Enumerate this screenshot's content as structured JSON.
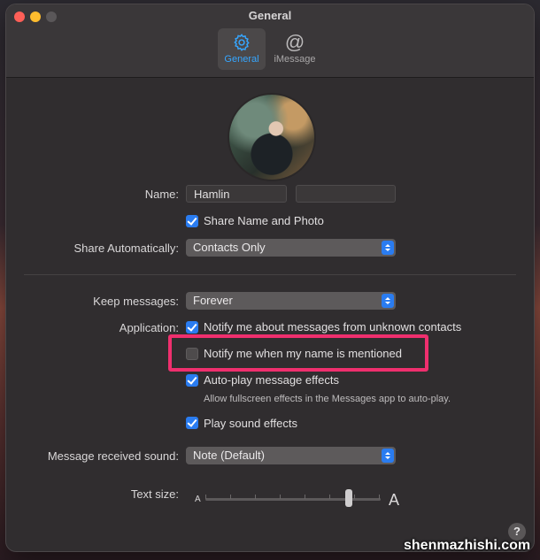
{
  "window": {
    "title": "General"
  },
  "tabs": [
    {
      "label": "General",
      "icon": "gear-icon",
      "active": true
    },
    {
      "label": "iMessage",
      "icon": "at-sign-icon",
      "active": false
    }
  ],
  "profile": {
    "name_label": "Name:",
    "first_name": "Hamlin",
    "last_name": "",
    "share_name_label": "Share Name and Photo",
    "share_auto_label": "Share Automatically:",
    "share_auto_value": "Contacts Only"
  },
  "settings": {
    "keep_label": "Keep messages:",
    "keep_value": "Forever",
    "application_label": "Application:",
    "notify_unknown": "Notify me about messages from unknown contacts",
    "notify_name": "Notify me when my name is mentioned",
    "autoplay": "Auto-play message effects",
    "autoplay_sub": "Allow fullscreen effects in the Messages app to auto-play.",
    "play_sound": "Play sound effects",
    "sound_label": "Message received sound:",
    "sound_value": "Note (Default)",
    "text_size_label": "Text size:",
    "text_size_small": "A",
    "text_size_large": "A",
    "text_size_level": 0.82
  },
  "help": "?",
  "watermark": "shenmazhishi.com",
  "colors": {
    "accent": "#2a7cf0",
    "highlight": "#ef2f6e"
  }
}
